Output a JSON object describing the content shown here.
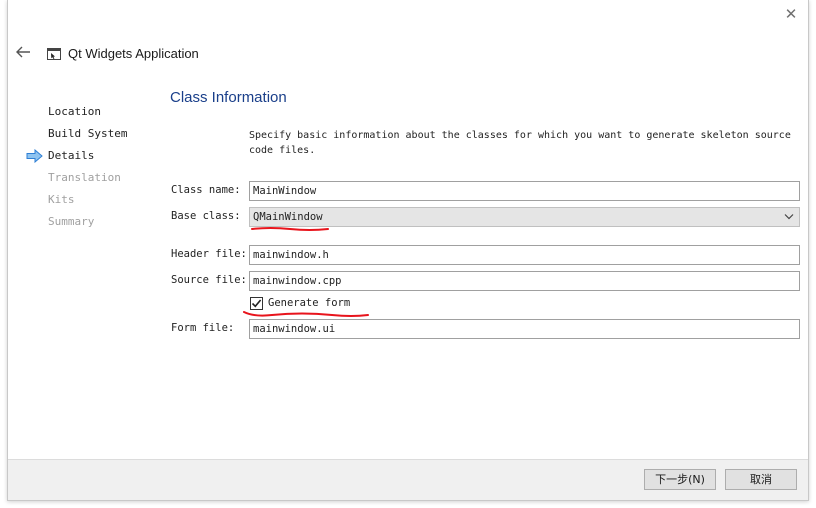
{
  "window": {
    "title": "Qt Widgets Application",
    "close_glyph": "✕"
  },
  "steps": [
    {
      "label": "Location",
      "state": "done"
    },
    {
      "label": "Build System",
      "state": "done"
    },
    {
      "label": "Details",
      "state": "current"
    },
    {
      "label": "Translation",
      "state": "disabled"
    },
    {
      "label": "Kits",
      "state": "disabled"
    },
    {
      "label": "Summary",
      "state": "disabled"
    }
  ],
  "page": {
    "title": "Class Information",
    "description": "Specify basic information about the classes for which you want to generate skeleton source code files."
  },
  "form": {
    "class_name": {
      "label": "Class name:",
      "value": "MainWindow"
    },
    "base_class": {
      "label": "Base class:",
      "value": "QMainWindow"
    },
    "header_file": {
      "label": "Header file:",
      "value": "mainwindow.h"
    },
    "source_file": {
      "label": "Source file:",
      "value": "mainwindow.cpp"
    },
    "generate_form": {
      "label": "Generate form",
      "checked": true
    },
    "form_file": {
      "label": "Form file:",
      "value": "mainwindow.ui"
    }
  },
  "footer": {
    "next_label": "下一步(N)",
    "cancel_label": "取消"
  },
  "colors": {
    "title_blue": "#1a3f8a",
    "annotation_red": "#e8141c",
    "current_step_arrow": "#2f7fd4"
  },
  "icons": {
    "back": "back-arrow-icon",
    "app": "qt-widgets-app-icon",
    "current_step": "current-step-arrow-icon",
    "combo": "chevron-down-icon",
    "check": "checkmark-icon"
  }
}
